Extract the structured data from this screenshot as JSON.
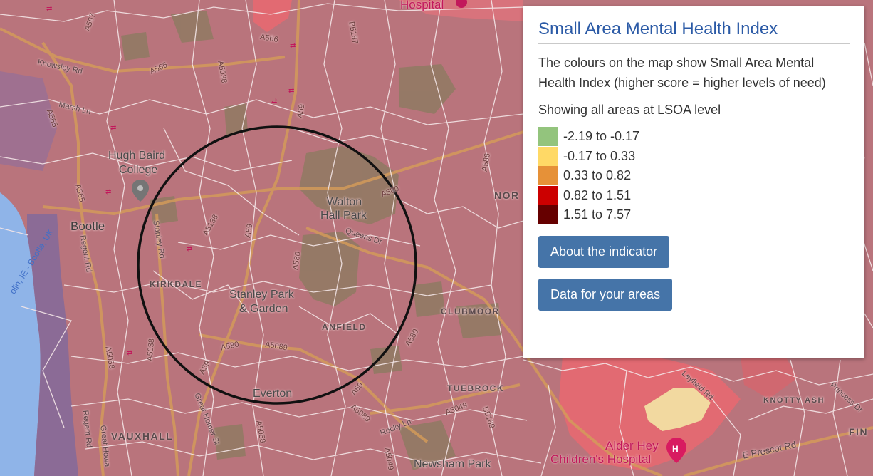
{
  "panel": {
    "title": "Small Area Mental Health Index",
    "description": "The colours on the map show Small Area Mental Health Index (higher score = higher levels of need)",
    "showing": "Showing all areas at LSOA level",
    "legend": [
      {
        "label": "-2.19 to -0.17",
        "color": "#93c47d"
      },
      {
        "label": "-0.17 to 0.33",
        "color": "#ffd966"
      },
      {
        "label": "0.33 to 0.82",
        "color": "#e69138"
      },
      {
        "label": "0.82 to 1.51",
        "color": "#cc0000"
      },
      {
        "label": "1.51 to 7.57",
        "color": "#660000"
      }
    ],
    "about_button": "About the indicator",
    "data_button": "Data for your areas"
  },
  "map": {
    "colors": {
      "base": "#b9747c",
      "water": "#8fb4e8",
      "park": "#8f7a63",
      "highlight_red": "#e26a72",
      "highlight_yellow": "#f2d9a0",
      "boundary": "#f4e6e7",
      "road_major": "#d39a5a"
    },
    "labels": {
      "hospital_top": "Hospital",
      "hugh_baird_1": "Hugh Baird",
      "hugh_baird_2": "College",
      "bootle": "Bootle",
      "walton_1": "Walton",
      "walton_2": "Hall Park",
      "queens_dr": "Queens Dr",
      "stanley_1": "Stanley Park",
      "stanley_2": "& Garden",
      "kirkdale": "KIRKDALE",
      "anfield": "ANFIELD",
      "clubmoor": "CLUBMOOR",
      "everton": "Everton",
      "tuebrook": "TUEBROCK",
      "vauxhall": "VAUXHALL",
      "newsham": "Newsham Park",
      "alder_1": "Alder Hey",
      "alder_2": "Children's Hospital",
      "knotty": "KNOTTY ASH",
      "nor": "NOR",
      "fin": "FIN",
      "e_prescot": "E Prescot Rd",
      "knowsley": "Knowsley Rd",
      "marsh": "Marsh Ln",
      "stanley_rd": "Stanley Rd",
      "regent_rd": "Regent Rd",
      "regent_rd_2": "Regent Rd",
      "great_howard": "Great Howa",
      "great_homer": "Great Homer St",
      "rocky": "Rocky Ln",
      "leyfield": "Leyfield Rd",
      "princess": "Princess Dr",
      "dublin": "olin, IE - Bootle, UK",
      "r_a566": "A566",
      "r_a566b": "A566",
      "r_a565": "A565",
      "r_a565b": "A565",
      "r_a5038": "A5038",
      "r_a5038b": "A5038",
      "r_a59": "A59",
      "r_a59b": "A59",
      "r_a59c": "A59",
      "r_a5138": "A5138",
      "r_a580": "A580",
      "r_a580b": "A580",
      "r_a580c": "A580",
      "r_a580d": "A580",
      "r_a5089": "A5089",
      "r_a5089b": "A5089",
      "r_a5049": "A5049",
      "r_b5189": "B5189",
      "r_a5058": "A5058",
      "r_a5058b": "A5058",
      "r_b5187": "B5187",
      "r_a567": "A567",
      "r_a5049b": "A5049",
      "r_a50": "A50",
      "r_a586": "A586"
    }
  }
}
